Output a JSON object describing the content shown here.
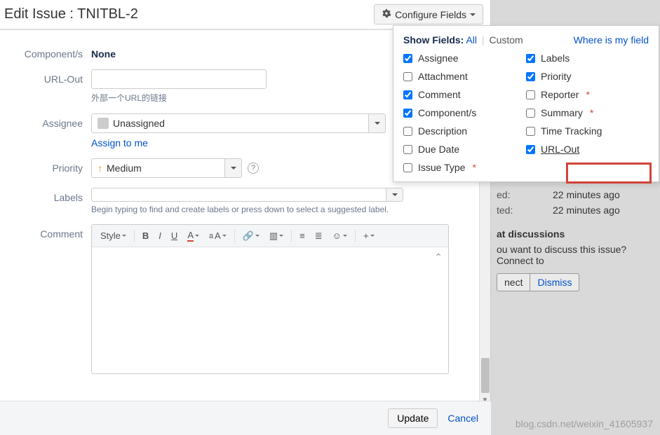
{
  "header": {
    "title": "Edit Issue : TNITBL-2",
    "configure": "Configure Fields"
  },
  "fields": {
    "components": {
      "label": "Component/s",
      "value": "None"
    },
    "urlout": {
      "label": "URL-Out",
      "value": "",
      "hint": "外部一个URL的链接"
    },
    "assignee": {
      "label": "Assignee",
      "value": "Unassigned",
      "action": "Assign to me"
    },
    "priority": {
      "label": "Priority",
      "value": "Medium"
    },
    "labels": {
      "label": "Labels",
      "hint": "Begin typing to find and create labels or press down to select a suggested label."
    },
    "comment": {
      "label": "Comment",
      "style_btn": "Style"
    }
  },
  "footer": {
    "update": "Update",
    "cancel": "Cancel"
  },
  "popup": {
    "show_fields": "Show Fields:",
    "all": "All",
    "custom": "Custom",
    "where": "Where is my field",
    "left": [
      {
        "label": "Assignee",
        "checked": true,
        "required": false
      },
      {
        "label": "Attachment",
        "checked": false,
        "required": false
      },
      {
        "label": "Comment",
        "checked": true,
        "required": false
      },
      {
        "label": "Component/s",
        "checked": true,
        "required": false
      },
      {
        "label": "Description",
        "checked": false,
        "required": false
      },
      {
        "label": "Due Date",
        "checked": false,
        "required": false
      },
      {
        "label": "Issue Type",
        "checked": false,
        "required": true
      }
    ],
    "right": [
      {
        "label": "Labels",
        "checked": true,
        "required": false
      },
      {
        "label": "Priority",
        "checked": true,
        "required": false
      },
      {
        "label": "Reporter",
        "checked": false,
        "required": true
      },
      {
        "label": "Summary",
        "checked": false,
        "required": true
      },
      {
        "label": "Time Tracking",
        "checked": false,
        "required": false
      },
      {
        "label": "URL-Out",
        "checked": true,
        "required": false,
        "underline": true
      }
    ]
  },
  "bg": {
    "r1l": "ed:",
    "r1v": "22 minutes ago",
    "r2l": "ted:",
    "r2v": "22 minutes ago",
    "heading": "at discussions",
    "text": "ou want to discuss this issue? Connect to",
    "btn1": "nect",
    "btn2": "Dismiss"
  },
  "watermark": "blog.csdn.net/weixin_41605937"
}
